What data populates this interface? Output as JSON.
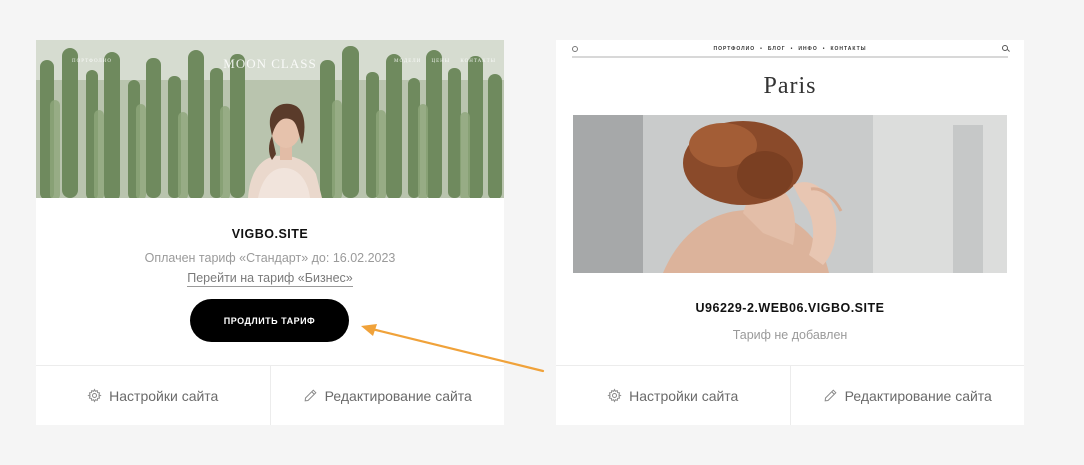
{
  "cards": [
    {
      "preview": {
        "logo": "MOON CLASS",
        "nav_left": "ПОРТФОЛИО",
        "nav_right": [
          "МОДЕЛИ",
          "ЦЕНЫ",
          "КОНТАКТЫ"
        ]
      },
      "site_name": "VIGBO.SITE",
      "plan_text": "Оплачен тариф «Стандарт» до: 16.02.2023",
      "upgrade_link": "Перейти на тариф «Бизнес»",
      "extend_button": "ПРОДЛИТЬ ТАРИФ",
      "settings_label": "Настройки сайта",
      "edit_label": "Редактирование сайта"
    },
    {
      "preview": {
        "menu": [
          "ПОРТФОЛИО",
          "БЛОГ",
          "ИНФО",
          "КОНТАКТЫ"
        ],
        "title": "Paris"
      },
      "site_name": "U96229-2.WEB06.VIGBO.SITE",
      "plan_text": "Тариф не добавлен",
      "settings_label": "Настройки сайта",
      "edit_label": "Редактирование сайта"
    }
  ],
  "colors": {
    "background": "#f5f5f5",
    "card": "#ffffff",
    "button": "#000000",
    "muted_text": "#9a9a9a",
    "arrow": "#f0a23a"
  },
  "icons": {
    "settings": "gear-icon",
    "edit": "pencil-icon",
    "search": "search-icon"
  }
}
